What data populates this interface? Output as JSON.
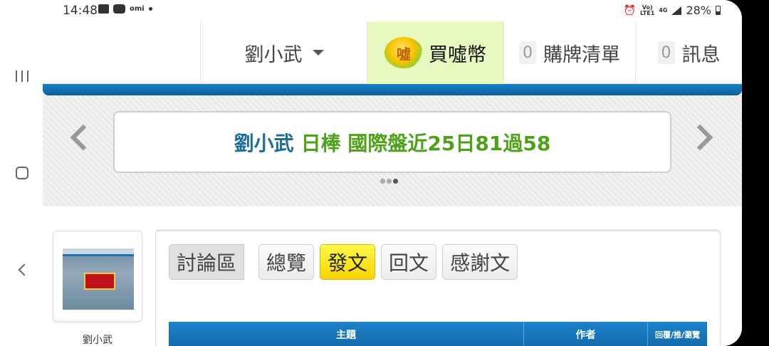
{
  "status_bar": {
    "time": "14:48",
    "app_label": "omi",
    "network_top": "Vo)",
    "network_bottom": "LTE1",
    "net_type": "4G",
    "battery": "28%"
  },
  "topnav": {
    "username": "劉小武",
    "buy_coin": "買噓幣",
    "coin_char": "噓",
    "cart_count": "0",
    "cart_label": "購牌清單",
    "msg_count": "0",
    "msg_label": "訊息"
  },
  "banner": {
    "name": "劉小武",
    "text": "日棒 國際盤近25日81過58",
    "dots_total": 3,
    "dots_active_index": 2
  },
  "profile": {
    "name": "劉小武"
  },
  "tabs": [
    {
      "label": "討論區"
    },
    {
      "label": "總覽"
    },
    {
      "label": "發文"
    },
    {
      "label": "回文"
    },
    {
      "label": "感謝文"
    }
  ],
  "table": {
    "col_subject": "主題",
    "col_author": "作者",
    "col_stats": "回覆/推/瀏覽"
  },
  "colors": {
    "accent_blue": "#1a80c8",
    "banner_name": "#1b6d9b",
    "banner_text": "#4ea21a",
    "active_tab": "#f8d300",
    "buy_bg": "#e7f9bf"
  }
}
